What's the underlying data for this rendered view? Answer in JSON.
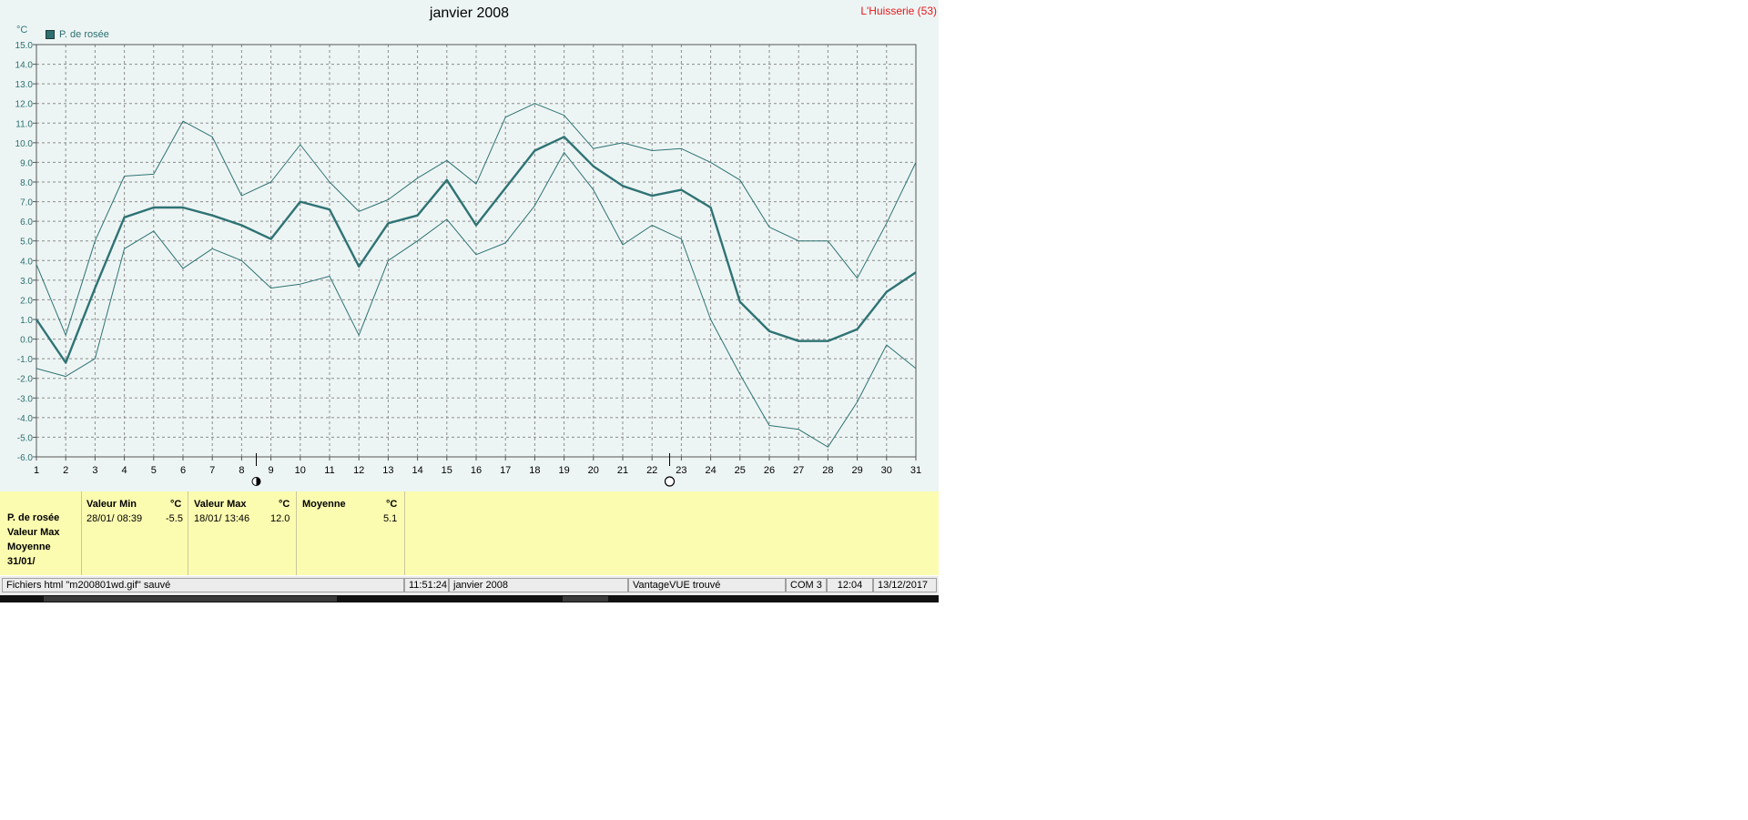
{
  "chart": {
    "title": "janvier 2008",
    "station": "L'Huisserie (53)",
    "y_unit": "°C",
    "legend_label": "P. de rosée",
    "colors": {
      "background": "#edf5f4",
      "series": "#2f7374",
      "grid": "#8c8c8c",
      "station": "#e8161b"
    }
  },
  "chart_data": {
    "type": "line",
    "title": "janvier 2008",
    "xlabel": "",
    "ylabel": "°C",
    "x": [
      1,
      2,
      3,
      4,
      5,
      6,
      7,
      8,
      9,
      10,
      11,
      12,
      13,
      14,
      15,
      16,
      17,
      18,
      19,
      20,
      21,
      22,
      23,
      24,
      25,
      26,
      27,
      28,
      29,
      30,
      31
    ],
    "x_ticks": [
      "1",
      "2",
      "3",
      "4",
      "5",
      "6",
      "7",
      "8",
      "9",
      "10",
      "11",
      "12",
      "13",
      "14",
      "15",
      "16",
      "17",
      "18",
      "19",
      "20",
      "21",
      "22",
      "23",
      "24",
      "25",
      "26",
      "27",
      "28",
      "29",
      "30",
      "31"
    ],
    "y_ticks": [
      "-6.0",
      "-5.0",
      "-4.0",
      "-3.0",
      "-2.0",
      "-1.0",
      "0.0",
      "1.0",
      "2.0",
      "3.0",
      "4.0",
      "5.0",
      "6.0",
      "7.0",
      "8.0",
      "9.0",
      "10.0",
      "11.0",
      "12.0",
      "13.0",
      "14.0",
      "15.0"
    ],
    "ylim": [
      -6,
      15
    ],
    "xlim": [
      1,
      31
    ],
    "grid": true,
    "legend_position": "top-left",
    "moon_phases": [
      {
        "x": 8.5,
        "phase": "last-quarter"
      },
      {
        "x": 22.6,
        "phase": "full"
      }
    ],
    "series": [
      {
        "name": "P. de rosée",
        "role": "max",
        "values": [
          3.8,
          0.2,
          5.0,
          8.3,
          8.4,
          11.1,
          10.3,
          7.3,
          8.0,
          9.9,
          8.0,
          6.5,
          7.1,
          8.2,
          9.1,
          7.9,
          11.3,
          12.0,
          11.4,
          9.7,
          10.0,
          9.6,
          9.7,
          9.0,
          8.1,
          5.7,
          5.0,
          5.0,
          3.1,
          5.9,
          9.0
        ]
      },
      {
        "name": "P. de rosée",
        "role": "mean",
        "values": [
          1.0,
          -1.2,
          2.6,
          6.2,
          6.7,
          6.7,
          6.3,
          5.8,
          5.1,
          7.0,
          6.6,
          3.7,
          5.9,
          6.3,
          8.1,
          5.8,
          7.7,
          9.6,
          10.3,
          8.8,
          7.8,
          7.3,
          7.6,
          6.7,
          1.9,
          0.4,
          -0.1,
          -0.1,
          0.5,
          2.4,
          3.4
        ]
      },
      {
        "name": "P. de rosée",
        "role": "min",
        "values": [
          -1.5,
          -1.9,
          -1.0,
          4.6,
          5.5,
          3.6,
          4.6,
          4.0,
          2.6,
          2.8,
          3.2,
          0.2,
          4.0,
          5.0,
          6.1,
          4.3,
          4.9,
          6.8,
          9.5,
          7.6,
          4.8,
          5.8,
          5.1,
          1.0,
          -1.8,
          -4.4,
          -4.6,
          -5.5,
          -3.2,
          -0.3,
          -1.5
        ]
      }
    ]
  },
  "stats": {
    "row_labels": [
      "P. de rosée",
      "Valeur Max",
      "Moyenne",
      "31/01/"
    ],
    "min": {
      "header": "Valeur Min",
      "unit": "°C",
      "datetime": "28/01/  08:39",
      "value": "-5.5"
    },
    "max": {
      "header": "Valeur Max",
      "unit": "°C",
      "datetime": "18/01/  13:46",
      "value": "12.0"
    },
    "avg": {
      "header": "Moyenne",
      "unit": "°C",
      "value": "5.1"
    }
  },
  "status_bar": {
    "message": "Fichiers html  \"m200801wd.gif\"  sauvé",
    "time": "11:51:24",
    "period": "janvier 2008",
    "device": "VantageVUE trouvé",
    "port": "COM 3",
    "clock": "12:04",
    "date": "13/12/2017"
  }
}
